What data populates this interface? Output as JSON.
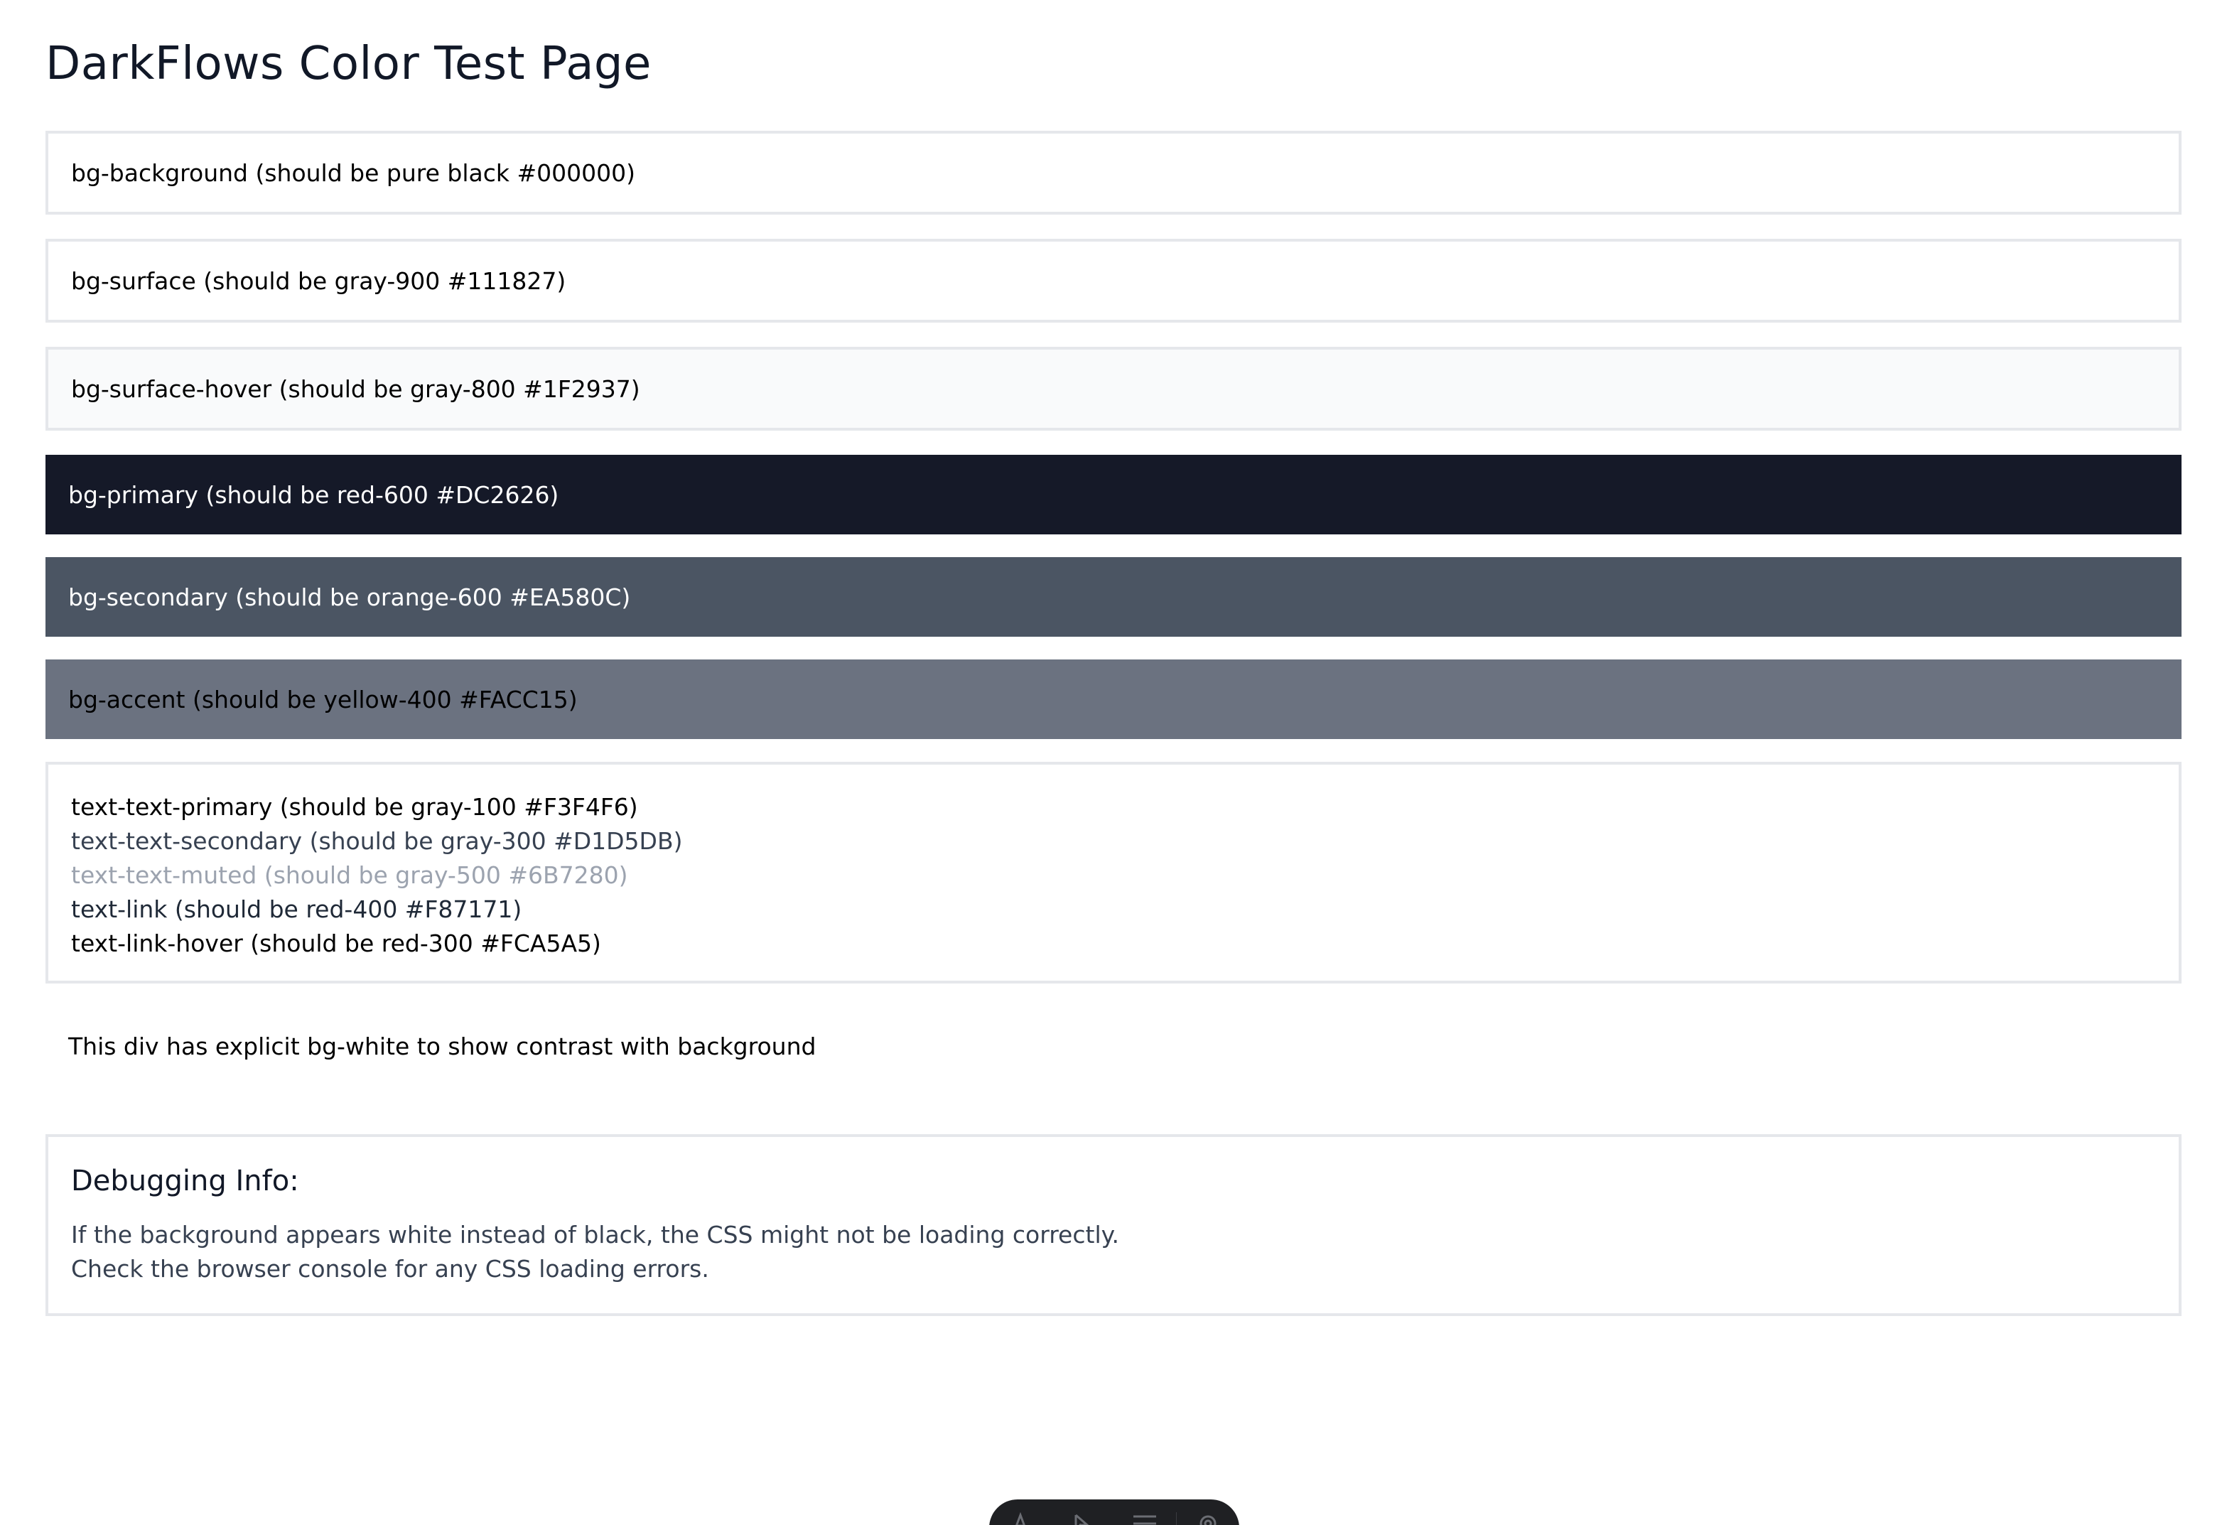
{
  "page": {
    "title": "DarkFlows Color Test Page"
  },
  "swatches": {
    "background": "bg-background (should be pure black #000000)",
    "surface": "bg-surface (should be gray-900 #111827)",
    "surface_hover": "bg-surface-hover (should be gray-800 #1F2937)",
    "primary": "bg-primary (should be red-600 #DC2626)",
    "secondary": "bg-secondary (should be orange-600 #EA580C)",
    "accent": "bg-accent (should be yellow-400 #FACC15)"
  },
  "text_samples": {
    "primary": "text-text-primary (should be gray-100 #F3F4F6)",
    "secondary": "text-text-secondary (should be gray-300 #D1D5DB)",
    "muted": "text-text-muted (should be gray-500 #6B7280)",
    "link": "text-link (should be red-400 #F87171)",
    "link_hover": "text-link-hover (should be red-300 #FCA5A5)"
  },
  "white_div": {
    "text": "This div has explicit bg-white to show contrast with background"
  },
  "debug": {
    "heading": "Debugging Info:",
    "line1": "If the background appears white instead of black, the CSS might not be loading correctly.",
    "line2": "Check the browser console for any CSS loading errors."
  },
  "colors": {
    "primary_box": "#151928",
    "secondary_box": "#4B5563",
    "accent_box": "#6B7280",
    "toolbar": "#1F2023"
  },
  "toolbar": {
    "icons": [
      "text-icon",
      "pointer-icon",
      "menu-icon",
      "settings-icon"
    ]
  }
}
